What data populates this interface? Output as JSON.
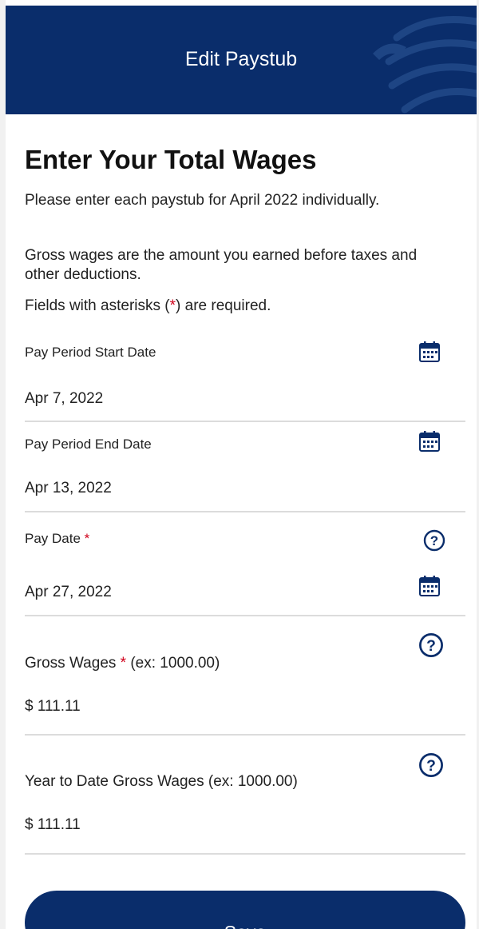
{
  "header": {
    "title": "Edit Paystub"
  },
  "page": {
    "title": "Enter Your Total Wages",
    "instructions": [
      "Please enter each paystub for April 2022 individually.",
      "Gross wages are the amount you earned before taxes and other deductions."
    ],
    "required_note": {
      "before": "Fields with asterisks (",
      "star": "*",
      "after": ") are required."
    }
  },
  "fields": {
    "start_date": {
      "label": "Pay Period Start Date",
      "value": "Apr 7, 2022",
      "icon": "calendar-icon"
    },
    "end_date": {
      "label": "Pay Period End Date",
      "value": "Apr 13, 2022",
      "icon": "calendar-icon"
    },
    "pay_date": {
      "label": "Pay Date",
      "required_mark": "*",
      "value": "Apr 27, 2022",
      "icons": [
        "help-icon",
        "calendar-icon"
      ]
    },
    "gross_wages": {
      "label": "Gross Wages",
      "required_mark": "*",
      "hint": "(ex: 1000.00)",
      "value": "$ 111.11",
      "icon": "help-icon"
    },
    "ytd_gross_wages": {
      "label": "Year to Date Gross Wages (ex: 1000.00)",
      "value": "$ 111.11",
      "icon": "help-icon"
    }
  },
  "actions": {
    "save_label": "Save"
  },
  "colors": {
    "brand": "#0a2d6b",
    "required": "#d0021b",
    "background": "#ffffff",
    "divider": "#dcdcdc"
  }
}
